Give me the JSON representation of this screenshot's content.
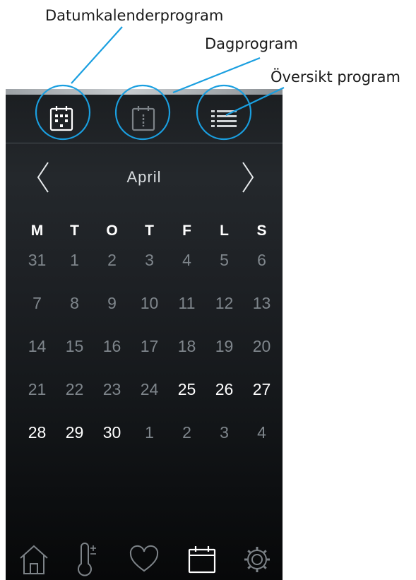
{
  "annotations": {
    "date_calendar": "Datumkalenderprogram",
    "day_program": "Dagprogram",
    "overview": "Översikt program"
  },
  "header": {
    "month": "April"
  },
  "weekdays": [
    "M",
    "T",
    "O",
    "T",
    "F",
    "L",
    "S"
  ],
  "weeks": [
    {
      "days": [
        {
          "n": "31",
          "active": false
        },
        {
          "n": "1",
          "active": false
        },
        {
          "n": "2",
          "active": false
        },
        {
          "n": "3",
          "active": false
        },
        {
          "n": "4",
          "active": false
        },
        {
          "n": "5",
          "active": false
        },
        {
          "n": "6",
          "active": false
        }
      ]
    },
    {
      "days": [
        {
          "n": "7",
          "active": false
        },
        {
          "n": "8",
          "active": false
        },
        {
          "n": "9",
          "active": false
        },
        {
          "n": "10",
          "active": false
        },
        {
          "n": "11",
          "active": false
        },
        {
          "n": "12",
          "active": false
        },
        {
          "n": "13",
          "active": false
        }
      ]
    },
    {
      "days": [
        {
          "n": "14",
          "active": false
        },
        {
          "n": "15",
          "active": false
        },
        {
          "n": "16",
          "active": false
        },
        {
          "n": "17",
          "active": false
        },
        {
          "n": "18",
          "active": false
        },
        {
          "n": "19",
          "active": false
        },
        {
          "n": "20",
          "active": false
        }
      ]
    },
    {
      "days": [
        {
          "n": "21",
          "active": false
        },
        {
          "n": "22",
          "active": false
        },
        {
          "n": "23",
          "active": false
        },
        {
          "n": "24",
          "active": false
        },
        {
          "n": "25",
          "active": true
        },
        {
          "n": "26",
          "active": true
        },
        {
          "n": "27",
          "active": true
        }
      ]
    },
    {
      "days": [
        {
          "n": "28",
          "active": true
        },
        {
          "n": "29",
          "active": true
        },
        {
          "n": "30",
          "active": true
        },
        {
          "n": "1",
          "active": false
        },
        {
          "n": "2",
          "active": false
        },
        {
          "n": "3",
          "active": false
        },
        {
          "n": "4",
          "active": false
        }
      ]
    }
  ],
  "icons": {
    "toolbar": [
      "calendar-date-icon",
      "calendar-day-icon",
      "list-icon"
    ],
    "bottom_nav": [
      "home-icon",
      "thermometer-icon",
      "heart-icon",
      "calendar-icon",
      "gear-icon"
    ]
  },
  "colors": {
    "highlight_circle": "#1a9fe0",
    "active_day": "#ffffff",
    "inactive_day": "#7f868c"
  }
}
